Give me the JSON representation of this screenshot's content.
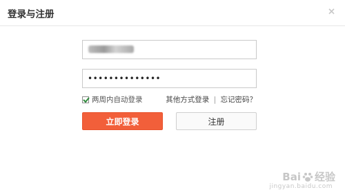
{
  "dialog": {
    "title": "登录与注册"
  },
  "form": {
    "password_mask": "••••••••••••••",
    "remember_label": "两周内自动登录",
    "remember_checked": true,
    "other_login_label": "其他方式登录",
    "separator": "|",
    "forgot_label": "忘记密码？"
  },
  "buttons": {
    "login_label": "立即登录",
    "register_label": "注册"
  },
  "watermark": {
    "text_left": "Bai",
    "text_right": "经验",
    "sub": "jingyan.baidu.com"
  },
  "colors": {
    "accent": "#f25f3a",
    "check": "#2f8a3b"
  }
}
